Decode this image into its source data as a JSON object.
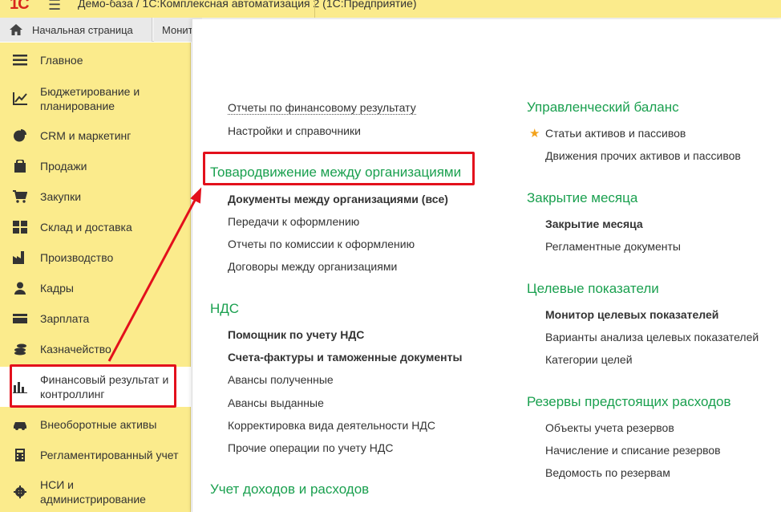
{
  "app": {
    "logo": "1С",
    "title": "Демо-база / 1С:Комплексная автоматизация 2  (1С:Предприятие)"
  },
  "tabs": {
    "home": "Начальная страница",
    "second": "Монит"
  },
  "sidebar": {
    "items": [
      {
        "label": "Главное",
        "icon": "menu-lines-icon"
      },
      {
        "label": "Бюджетирование и планирование",
        "icon": "budget-chart-icon"
      },
      {
        "label": "CRM и маркетинг",
        "icon": "pie-icon"
      },
      {
        "label": "Продажи",
        "icon": "bag-icon"
      },
      {
        "label": "Закупки",
        "icon": "cart-icon"
      },
      {
        "label": "Склад и доставка",
        "icon": "warehouse-icon"
      },
      {
        "label": "Производство",
        "icon": "factory-icon"
      },
      {
        "label": "Кадры",
        "icon": "person-icon"
      },
      {
        "label": "Зарплата",
        "icon": "card-icon"
      },
      {
        "label": "Казначейство",
        "icon": "coins-icon"
      },
      {
        "label": "Финансовый результат и контроллинг",
        "icon": "bar-chart-icon",
        "active": true
      },
      {
        "label": "Внеоборотные активы",
        "icon": "car-icon"
      },
      {
        "label": "Регламентированный учет",
        "icon": "calculator-icon"
      },
      {
        "label": "НСИ и администрирование",
        "icon": "gear-icon"
      }
    ]
  },
  "content": {
    "col1": {
      "top_links": [
        "Отчеты по финансовому результату",
        "Настройки и справочники"
      ],
      "section_trade": {
        "title": "Товародвижение между организациями",
        "links": [
          "Документы между организациями (все)",
          "Передачи к оформлению",
          "Отчеты по комиссии к оформлению",
          "Договоры между организациями"
        ]
      },
      "section_vat": {
        "title": "НДС",
        "links": [
          "Помощник по учету НДС",
          "Счета-фактуры и таможенные документы",
          "Авансы полученные",
          "Авансы выданные",
          "Корректировка вида деятельности НДС",
          "Прочие операции по учету НДС"
        ]
      },
      "section_income": {
        "title": "Учет доходов и расходов"
      }
    },
    "col2": {
      "section_balance": {
        "title": "Управленческий баланс",
        "links": [
          "Статьи активов и пассивов",
          "Движения прочих активов и пассивов"
        ]
      },
      "section_close": {
        "title": "Закрытие месяца",
        "links": [
          "Закрытие месяца",
          "Регламентные документы"
        ]
      },
      "section_targets": {
        "title": "Целевые показатели",
        "links": [
          "Монитор целевых показателей",
          "Варианты анализа целевых показателей",
          "Категории целей"
        ]
      },
      "section_reserves": {
        "title": "Резервы предстоящих расходов",
        "links": [
          "Объекты учета резервов",
          "Начисление и списание резервов",
          "Ведомость по резервам"
        ]
      }
    }
  },
  "colors": {
    "sidebar_bg": "#fbeb8c",
    "section_header": "#1aa04f",
    "highlight": "#e3101c",
    "star": "#f3a21a"
  }
}
